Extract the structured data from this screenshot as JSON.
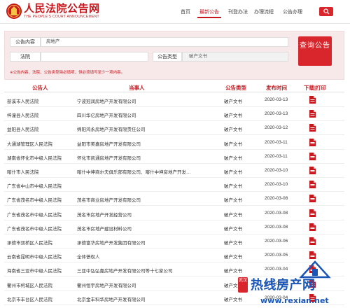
{
  "header": {
    "brand_title": "人民法院公告网",
    "brand_sub": "THE PEOPLE'S COURT ANNOUNCEMENT",
    "nav": [
      {
        "label": "首页",
        "active": false
      },
      {
        "label": "最新公告",
        "active": true
      },
      {
        "label": "刊登办法",
        "active": false
      },
      {
        "label": "办理流程",
        "active": false
      },
      {
        "label": "公告办理",
        "active": false
      }
    ],
    "accent": "#c8161d"
  },
  "search": {
    "content_label": "公告内容",
    "content_value": "房地产",
    "court_label": "法院",
    "court_value": "",
    "type_label": "公告类型",
    "type_value": "破产文书",
    "query_label": "查询公告",
    "hint": "※公告内容、法院、公告类型除必填项，但必须填写至少一项内容。"
  },
  "table": {
    "headers": [
      "公告人",
      "当事人",
      "公告类型",
      "发布时间",
      "下载|打印"
    ],
    "rows": [
      [
        "慈溪市人民法院",
        "宁波冠润房地产开发有限公司",
        "破产文书",
        "2020-03-13"
      ],
      [
        "梓潼县人民法院",
        "四川华亿房地产开发有限公司",
        "破产文书",
        "2020-03-13"
      ],
      [
        "益阳县人民法院",
        "绵阳鸿永房地产开发有限责任公司",
        "破产文书",
        "2020-03-12"
      ],
      [
        "大通湖管理区人民法院",
        "益阳市美嘉房地产开发有限公司",
        "破产文书",
        "2020-03-11"
      ],
      [
        "湖南省怀化市中级人民法院",
        "怀化市凯通房地产开发有限公司",
        "破产文书",
        "2020-03-11"
      ],
      [
        "喀什市人民法院",
        "喀什中坤商尔夫俱乐部有限公司、喀什中坤房地产开发…",
        "破产文书",
        "2020-03-10"
      ],
      [
        "广东省中山市中级人民法院",
        "",
        "破产文书",
        "2020-03-10"
      ],
      [
        "广东省茂名市中级人民法院",
        "茂名市商业房地产开发有限公司",
        "破产文书",
        "2020-03-08"
      ],
      [
        "广东省茂名市中级人民法院",
        "茂名市房地产开发经营公司",
        "破产文书",
        "2020-03-08"
      ],
      [
        "广东省茂名市中级人民法院",
        "茂名市房地产建设材料公司",
        "破产文书",
        "2020-03-08"
      ],
      [
        "承德市双桥区人民法院",
        "承德富华房地产开发集团有限公司",
        "破产文书",
        "2020-03-06"
      ],
      [
        "云南省昆明市中级人民法院",
        "全体债权人",
        "破产文书",
        "2020-03-05"
      ],
      [
        "海南省三亚市中级人民法院",
        "三亚中弘弘嘉房地产开发有限公司等十七家公司",
        "破产文书",
        "2020-03-04"
      ],
      [
        "衢州市柯城区人民法院",
        "衢州恒宇房地产开发有限公司",
        "破产文书",
        "2020-03-04"
      ],
      [
        "北京市丰台区人民法院",
        "北京金丰科华房地产开发有限公司",
        "破产文书",
        "2020-03-04"
      ]
    ]
  },
  "watermark": {
    "badge": "武汉",
    "title": "热线房产网",
    "url": "www.rexian.net"
  }
}
